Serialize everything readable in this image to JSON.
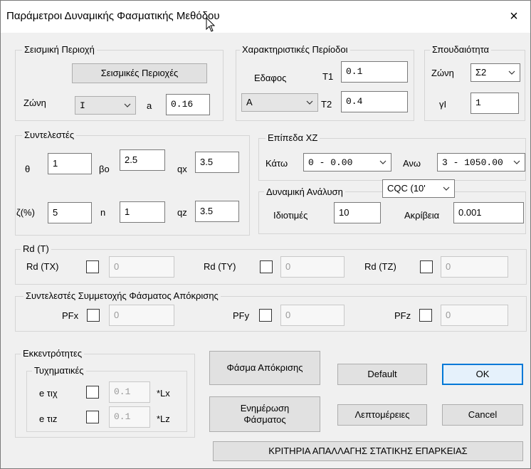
{
  "window": {
    "title": "Παράμετροι Δυναμικής Φασματικής Μεθόδου",
    "close_glyph": "×"
  },
  "seismic_region": {
    "legend": "Σεισμική Περιοχή",
    "button_label": "Σεισμικές Περιοχές",
    "zone_label": "Ζώνη",
    "zone_value": "I",
    "a_label": "a",
    "a_value": "0.16"
  },
  "char_periods": {
    "legend": "Χαρακτηριστικές Περίοδοι",
    "soil_label": "Εδαφος",
    "t1_label": "T1",
    "t1_value": "0.1",
    "soil_value": "A",
    "t2_label": "T2",
    "t2_value": "0.4"
  },
  "importance": {
    "legend": "Σπουδαιότητα",
    "zone_label": "Ζώνη",
    "zone_value": "Σ2",
    "gi_label": "γΙ",
    "gi_value": "1"
  },
  "coefficients": {
    "legend": "Συντελεστές",
    "theta_label": "θ",
    "theta_value": "1",
    "bo_label": "βο",
    "bo_value": "2.5",
    "qx_label": "qx",
    "qx_value": "3.5",
    "zeta_label": "ζ(%)",
    "zeta_value": "5",
    "n_label": "n",
    "n_value": "1",
    "qz_label": "qz",
    "qz_value": "3.5"
  },
  "xz_levels": {
    "legend": "Επίπεδα XZ",
    "low_label": "Κάτω",
    "low_value": "0 - 0.00",
    "high_label": "Ανω",
    "high_value": "3 - 1050.00"
  },
  "dynamic": {
    "legend": "Δυναμική Ανάλυση",
    "method_value": "CQC (10'",
    "modes_label": "Ιδιοτιμές",
    "modes_value": "10",
    "accuracy_label": "Ακρίβεια",
    "accuracy_value": "0.001"
  },
  "rd": {
    "legend": "Rd (T)",
    "tx_label": "Rd (TX)",
    "tx_value": "0",
    "ty_label": "Rd (TY)",
    "ty_value": "0",
    "tz_label": "Rd (TZ)",
    "tz_value": "0"
  },
  "pf": {
    "legend": "Συντελεστές Συμμετοχής Φάσματος Απόκρισης",
    "x_label": "PFx",
    "x_value": "0",
    "y_label": "PFy",
    "y_value": "0",
    "z_label": "PFz",
    "z_value": "0"
  },
  "eccentricity": {
    "legend": "Εκκεντρότητες",
    "accidental_legend": "Τυχηματικές",
    "ex_label": "e τιχ",
    "ex_value": "0.1",
    "ex_unit": "*Lx",
    "ez_label": "e τιz",
    "ez_value": "0.1",
    "ez_unit": "*Lz"
  },
  "buttons": {
    "spectrum": "Φάσμα Απόκρισης",
    "default": "Default",
    "ok": "OK",
    "update_line1": "Ενημέρωση",
    "update_line2": "Φάσματος",
    "details": "Λεπτομέρειες",
    "cancel": "Cancel",
    "criteria": "ΚΡΙΤΗΡΙΑ ΑΠΑΛΛΑΓΗΣ ΣΤΑΤΙΚΗΣ ΕΠΑΡΚΕΙΑΣ"
  }
}
